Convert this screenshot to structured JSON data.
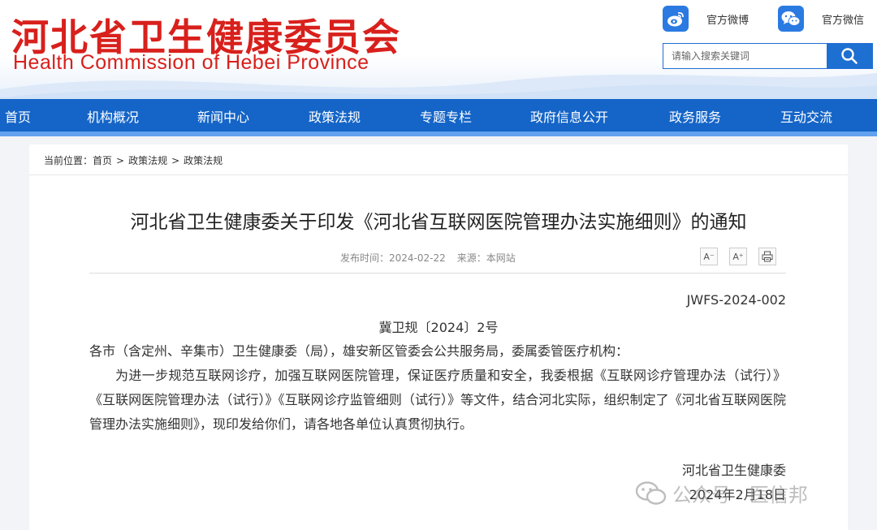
{
  "header": {
    "org_name_cn": "河北省卫生健康委员会",
    "org_name_en": "Health Commission of Hebei Province",
    "weibo_label": "官方微博",
    "wechat_label": "官方微信",
    "search_placeholder": "请输入搜索关键词"
  },
  "nav": {
    "items": [
      "首页",
      "机构概况",
      "新闻中心",
      "政策法规",
      "专题专栏",
      "政府信息公开",
      "政务服务",
      "互动交流"
    ]
  },
  "breadcrumb": {
    "prefix": "当前位置：",
    "items": [
      "首页",
      "政策法规",
      "政策法规"
    ],
    "separator": ">"
  },
  "article": {
    "title": "河北省卫生健康委关于印发《河北省互联网医院管理办法实施细则》的通知",
    "publish_time": "发布时间：2024-02-22",
    "source": "来源：本网站",
    "tools": {
      "font_decrease": "A⁻",
      "font_increase": "A⁺"
    },
    "doc_code": "JWFS-2024-002",
    "doc_number": "冀卫规〔2024〕2号",
    "recipients": "各市（含定州、辛集市）卫生健康委（局），雄安新区管委会公共服务局，委属委管医疗机构：",
    "body": "为进一步规范互联网诊疗，加强互联网医院管理，保证医疗质量和安全，我委根据《互联网诊疗管理办法（试行）》《互联网医院管理办法（试行）》《互联网诊疗监管细则（试行）》等文件，结合河北实际，组织制定了《河北省互联网医院管理办法实施细则》，现印发给你们，请各地各单位认真贯彻执行。",
    "signature": "河北省卫生健康委",
    "date": "2024年2月18日"
  },
  "watermark": {
    "text": "公众号 · 医信邦"
  },
  "colors": {
    "brand_red": "#d8201c",
    "nav_blue": "#1565c8",
    "nav_border": "#62a2ef",
    "accent_blue": "#1e6fd2"
  }
}
